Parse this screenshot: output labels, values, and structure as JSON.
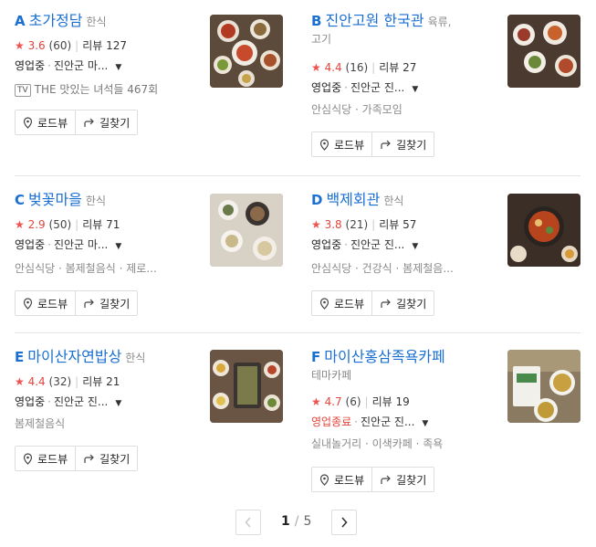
{
  "results": [
    {
      "letter": "A",
      "name": "초가정담",
      "category": "한식",
      "rating": "3.6",
      "count": "(60)",
      "reviews": "리뷰 127",
      "status": "영업중",
      "address": "진안군 마...",
      "extra": "THE 맛있는 녀석들 467회",
      "extra_badge": "TV"
    },
    {
      "letter": "B",
      "name": "진안고원 한국관",
      "category": "육류,",
      "category2": "고기",
      "rating": "4.4",
      "count": "(16)",
      "reviews": "리뷰 27",
      "status": "영업중",
      "address": "진안군 진...",
      "tags": "안심식당 · 가족모임"
    },
    {
      "letter": "C",
      "name": "벚꽃마을",
      "category": "한식",
      "rating": "2.9",
      "count": "(50)",
      "reviews": "리뷰 71",
      "status": "영업중",
      "address": "진안군 마...",
      "tags": "안심식당 · 봄제철음식 · 제로..."
    },
    {
      "letter": "D",
      "name": "백제회관",
      "category": "한식",
      "rating": "3.8",
      "count": "(21)",
      "reviews": "리뷰 57",
      "status": "영업중",
      "address": "진안군 진...",
      "tags": "안심식당 · 건강식 · 봄제철음..."
    },
    {
      "letter": "E",
      "name": "마이산자연밥상",
      "category": "한식",
      "rating": "4.4",
      "count": "(32)",
      "reviews": "리뷰 21",
      "status": "영업중",
      "address": "진안군 진...",
      "tags": "봄제철음식"
    },
    {
      "letter": "F",
      "name": "마이산홍삼족욕카페",
      "category": "",
      "category2": "테마카페",
      "rating": "4.7",
      "count": "(6)",
      "reviews": "리뷰 19",
      "status": "영업종료",
      "address": "진안군 진...",
      "tags": "실내놀거리 · 이색카페 · 족욕"
    }
  ],
  "buttons": {
    "roadview": "로드뷰",
    "directions": "길찾기"
  },
  "pagination": {
    "current": "1",
    "separator": "/",
    "total": "5"
  },
  "colors": {
    "link": "#1a6fd1",
    "star": "#ef5350",
    "closed": "#e2453c"
  },
  "icons": [
    "star-icon",
    "tv-icon",
    "location-pin-icon",
    "turn-arrow-icon",
    "chevron-left-icon",
    "chevron-right-icon",
    "caret-down-icon"
  ]
}
